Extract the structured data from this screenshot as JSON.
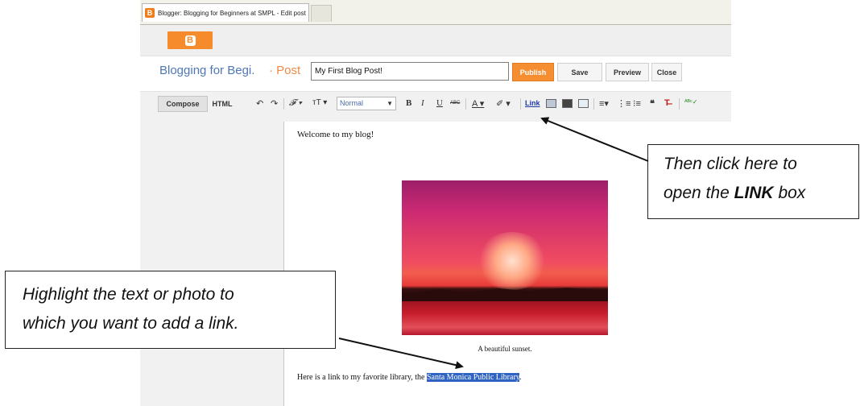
{
  "browser": {
    "tab_title": "Blogger: Blogging for Beginners at SMPL - Edit post",
    "favicon_glyph": "B"
  },
  "navbar": {
    "logo_glyph": "B"
  },
  "postbar": {
    "blog_title": "Blogging for Begi.",
    "post_label": "· Post",
    "title_value": "My First Blog Post!",
    "publish_label": "Publish",
    "save_label": "Save",
    "preview_label": "Preview",
    "close_label": "Close"
  },
  "toolbar": {
    "compose_label": "Compose",
    "html_label": "HTML",
    "undo_glyph": "↶",
    "redo_glyph": "↷",
    "font_glyph": "𝓕 ▾",
    "size_glyph": "тT ▾",
    "format_value": "Normal",
    "bold_glyph": "B",
    "italic_glyph": "I",
    "underline_glyph": "U",
    "strike_glyph": "ABC",
    "textcolor_glyph": "A ▾",
    "highlight_glyph": "✐ ▾",
    "link_label": "Link",
    "align_glyph": "≡▾",
    "numbered_glyph": "⋮≡",
    "bullets_glyph": "⁝≡",
    "quote_glyph": "❝",
    "clear_glyph": "T̶",
    "spell_glyph": "ᴬᴮᶜ✓"
  },
  "editor": {
    "welcome_text": "Welcome to my blog!",
    "image_caption": "A beautiful sunset.",
    "link_sentence_prefix": "Here is a link to my favorite library, the",
    "highlighted_text": "Santa Monica Public Library",
    "link_sentence_suffix": "."
  },
  "annotations": {
    "link_callout_line1": "Then click here to",
    "link_callout_line2_prefix": "open the",
    "link_callout_line2_bold": "LINK",
    "link_callout_line2_suffix": "box",
    "highlight_callout_line1": "Highlight the text or photo to",
    "highlight_callout_line2": "which you want to add a link."
  },
  "colors": {
    "publish_orange": "#f48e31",
    "blog_title_blue": "#4f77b8",
    "selection_blue": "#2f63c1"
  }
}
